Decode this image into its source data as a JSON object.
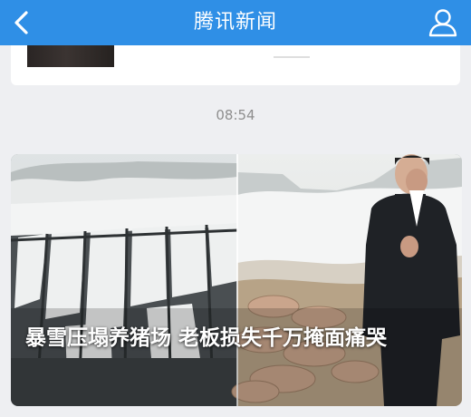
{
  "navbar": {
    "title": "腾讯新闻",
    "back_icon": "chevron-left-icon",
    "user_icon": "user-icon"
  },
  "chat": {
    "timestamp": "08:54"
  },
  "news_card": {
    "headline": "暴雪压塌养猪场 老板损失千万掩面痛哭"
  },
  "colors": {
    "navbar": "#2f8fe6",
    "background": "#eeeff2",
    "card": "#ffffff"
  }
}
